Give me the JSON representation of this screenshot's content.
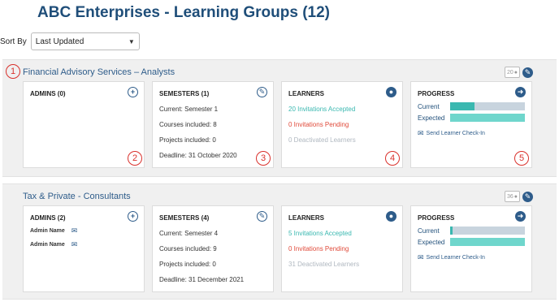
{
  "header": {
    "title": "ABC Enterprises  - Learning Groups (12)"
  },
  "sort": {
    "label": "Sort By",
    "selected": "Last Updated"
  },
  "groups": [
    {
      "title": "Financial Advisory Services – Analysts",
      "member_count": "20",
      "admins": {
        "title": "ADMINS (0)",
        "names": []
      },
      "semesters": {
        "title": "SEMESTERS (1)",
        "current": "Current: Semester 1",
        "courses": "Courses included: 8",
        "projects": "Projects included: 0",
        "deadline": "Deadline: 31 October 2020"
      },
      "learners": {
        "title": "LEARNERS",
        "accepted": "20 Invitations Accepted",
        "pending": "0 Invitations Pending",
        "deactivated": "0 Deactivated Learners"
      },
      "progress": {
        "title": "PROGRESS",
        "current_label": "Current",
        "expected_label": "Expected",
        "current_fraction": 0.32,
        "expected_fraction": 1.0,
        "checkin": "Send Learner Check-In"
      }
    },
    {
      "title": "Tax & Private - Consultants",
      "member_count": "36",
      "admins": {
        "title": "ADMINS (2)",
        "names": [
          "Admin Name",
          "Admin Name"
        ]
      },
      "semesters": {
        "title": "SEMESTERS (4)",
        "current": "Current: Semester 4",
        "courses": "Courses included: 9",
        "projects": "Projects included: 0",
        "deadline": "Deadline: 31 December 2021"
      },
      "learners": {
        "title": "LEARNERS",
        "accepted": "5 Invitations Accepted",
        "pending": "0 Invitations Pending",
        "deactivated": "31 Deactivated Learners"
      },
      "progress": {
        "title": "PROGRESS",
        "current_label": "Current",
        "expected_label": "Expected",
        "current_fraction": 0.03,
        "expected_fraction": 1.0,
        "checkin": "Send Learner Check-In"
      }
    }
  ],
  "markers": [
    "1",
    "2",
    "3",
    "4",
    "5"
  ],
  "colors": {
    "accent": "#2e5c8a",
    "teal": "#3ab8b0",
    "pending_red": "#e04a3a",
    "marker_red": "#d9312c"
  }
}
